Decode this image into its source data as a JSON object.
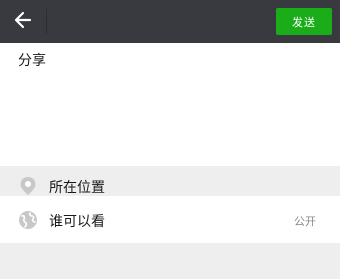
{
  "header": {
    "back_icon": "arrow-left-icon",
    "send_label": "发送",
    "send_color": "#1aad19",
    "bar_color": "#393a3f"
  },
  "compose": {
    "text": "分享"
  },
  "location": {
    "icon": "location-pin-icon",
    "label": "所在位置"
  },
  "visibility": {
    "icon": "globe-icon",
    "label": "谁可以看",
    "value": "公开"
  }
}
